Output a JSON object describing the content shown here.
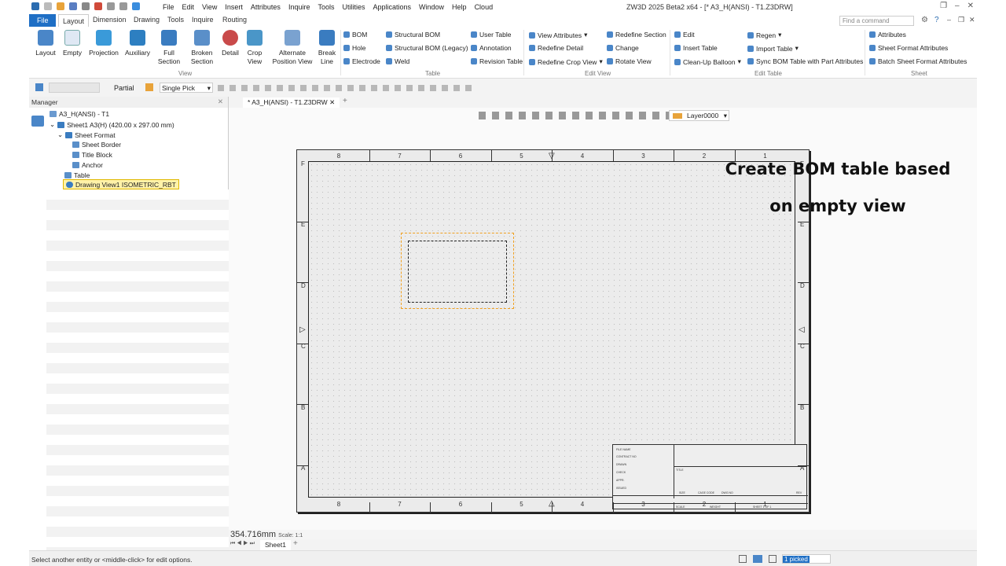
{
  "window": {
    "title": "ZW3D 2025 Beta2 x64 - [* A3_H(ANSI) - T1.Z3DRW]"
  },
  "menu": [
    "File",
    "Edit",
    "View",
    "Insert",
    "Attributes",
    "Inquire",
    "Tools",
    "Utilities",
    "Applications",
    "Window",
    "Help",
    "Cloud"
  ],
  "ribbon_tabs": [
    "File",
    "Layout",
    "Dimension",
    "Drawing",
    "Tools",
    "Inquire",
    "Routing"
  ],
  "search": {
    "placeholder": "Find a command"
  },
  "ribbon": {
    "view_group": {
      "label": "View",
      "buttons": [
        "Layout",
        "Empty",
        "Projection",
        "Auxiliary",
        "Full Section",
        "Broken Section",
        "Detail",
        "Crop View",
        "Alternate Position View",
        "Break Line"
      ]
    },
    "table_group": {
      "label": "Table",
      "items": [
        "BOM",
        "Hole",
        "Electrode",
        "Structural BOM",
        "Structural BOM (Legacy)",
        "Weld",
        "User Table",
        "Annotation",
        "Revision Table"
      ]
    },
    "edit_view_group": {
      "label": "Edit View",
      "items": [
        "View Attributes",
        "Redefine Detail",
        "Redefine Crop View",
        "Redefine Section",
        "Change",
        "Rotate View"
      ]
    },
    "edit_table_group": {
      "label": "Edit Table",
      "items": [
        "Edit",
        "Insert Table",
        "Clean-Up Balloon",
        "Regen",
        "Import Table",
        "Sync BOM Table with Part Attributes"
      ]
    },
    "sheet_group": {
      "label": "Sheet",
      "items": [
        "Attributes",
        "Sheet Format Attributes",
        "Batch Sheet Format Attributes"
      ]
    }
  },
  "toolbar": {
    "filter": "Partial",
    "pick": "Single Pick",
    "layer": "Layer0000"
  },
  "manager": {
    "title": "Manager",
    "tree": [
      "A3_H(ANSI) - T1",
      "Sheet1 A3(H) (420.00 x 297.00 mm)",
      "Sheet Format",
      "Sheet Border",
      "Title Block",
      "Anchor",
      "Table",
      "Drawing View1 ISOMETRIC_RBT"
    ]
  },
  "doc_tab": "* A3_H(ANSI) - T1.Z3DRW",
  "zones": {
    "cols": [
      "8",
      "7",
      "6",
      "5",
      "4",
      "3",
      "2",
      "1"
    ],
    "rows": [
      "F",
      "E",
      "D",
      "C",
      "B",
      "A"
    ]
  },
  "title_block": {
    "fields": [
      "FILE NAME",
      "CONTRACT NO",
      "DRAWN",
      "CHECK",
      "APPR.",
      "ISSUED",
      "SIZE",
      "CAGE CODE",
      "DWG NO",
      "REV",
      "SCALE",
      "WEIGHT",
      "SHEET 1 OF 1",
      "TITLE"
    ]
  },
  "overlay": {
    "line1": "Create BOM table based",
    "line2": "on empty view"
  },
  "readout": {
    "value": "354.716mm",
    "scale": "Scale: 1:1"
  },
  "sheet_tab": "Sheet1",
  "status": {
    "prompt": "Select another entity or <middle-click> for edit options.",
    "picked": "1 picked"
  }
}
